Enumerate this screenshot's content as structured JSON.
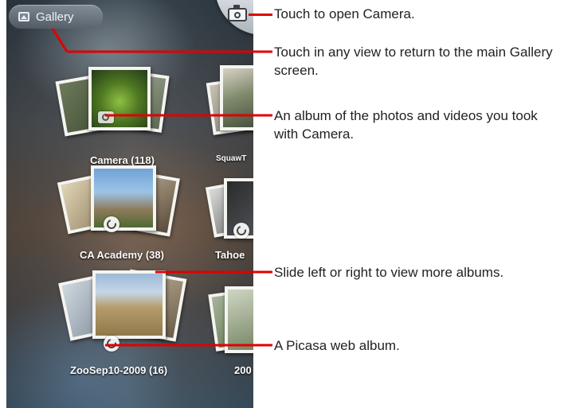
{
  "screen": {
    "gallery_button_label": "Gallery"
  },
  "albums": [
    {
      "label": "Camera  (118)",
      "overlay": "camera-icon"
    },
    {
      "label": "SquawT",
      "overlay": "none"
    },
    {
      "label": "CA Academy  (38)",
      "overlay": "picasa-icon"
    },
    {
      "label": "Tahoe",
      "overlay": "picasa-icon"
    },
    {
      "label": "ZooSep10-2009  (16)",
      "overlay": "picasa-icon"
    },
    {
      "label": "200",
      "overlay": "none"
    }
  ],
  "callouts": {
    "camera": "Touch to open Camera.",
    "gallery": "Touch in any view to return to the main Gallery screen.",
    "camera_album": "An album of the photos and videos you took with Camera.",
    "slide": "Slide left or right to view more albums.",
    "picasa": "A Picasa web album."
  },
  "colors": {
    "callout_line": "#e00000"
  }
}
